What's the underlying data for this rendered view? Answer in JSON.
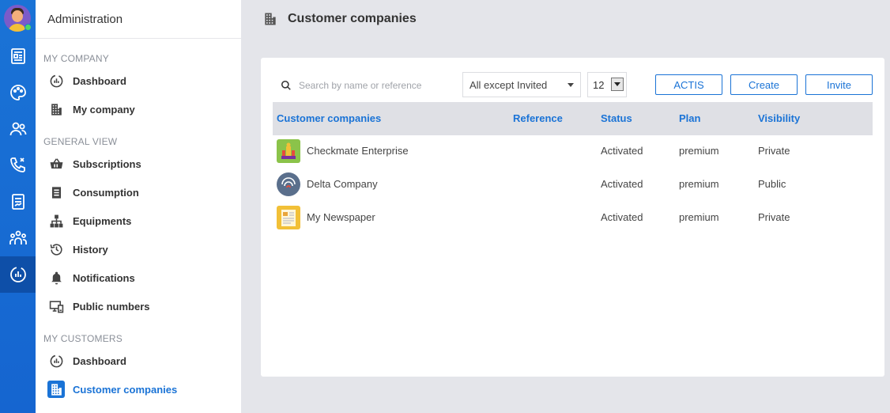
{
  "sidebar": {
    "header": "Administration",
    "sections": {
      "my_company": "MY COMPANY",
      "general_view": "GENERAL VIEW",
      "my_customers": "MY CUSTOMERS"
    },
    "items": {
      "dashboard": "Dashboard",
      "my_company": "My company",
      "subscriptions": "Subscriptions",
      "consumption": "Consumption",
      "equipments": "Equipments",
      "history": "History",
      "notifications": "Notifications",
      "public_numbers": "Public numbers",
      "customers_dashboard": "Dashboard",
      "customer_companies": "Customer companies"
    }
  },
  "topbar": {
    "title": "Customer companies",
    "icon": "building-icon"
  },
  "toolbar": {
    "search_placeholder": "Search by name or reference",
    "filter_value": "All except Invited",
    "page_size": "12",
    "actis_label": "ACTIS",
    "create_label": "Create",
    "invite_label": "Invite"
  },
  "table": {
    "columns": {
      "name": "Customer companies",
      "reference": "Reference",
      "status": "Status",
      "plan": "Plan",
      "visibility": "Visibility"
    },
    "rows": [
      {
        "name": "Checkmate Enterprise",
        "reference": "",
        "status": "Activated",
        "plan": "premium",
        "visibility": "Private",
        "logo_color": "#8bc34a"
      },
      {
        "name": "Delta Company",
        "reference": "",
        "status": "Activated",
        "plan": "premium",
        "visibility": "Public",
        "logo_color": "#5a6f8c"
      },
      {
        "name": "My Newspaper",
        "reference": "",
        "status": "Activated",
        "plan": "premium",
        "visibility": "Private",
        "logo_color": "#f2c037"
      }
    ]
  },
  "colors": {
    "accent": "#1a73d6",
    "rail": "#1a73d6",
    "rail_active": "#0e4fa8",
    "presence": "#4cd964"
  }
}
